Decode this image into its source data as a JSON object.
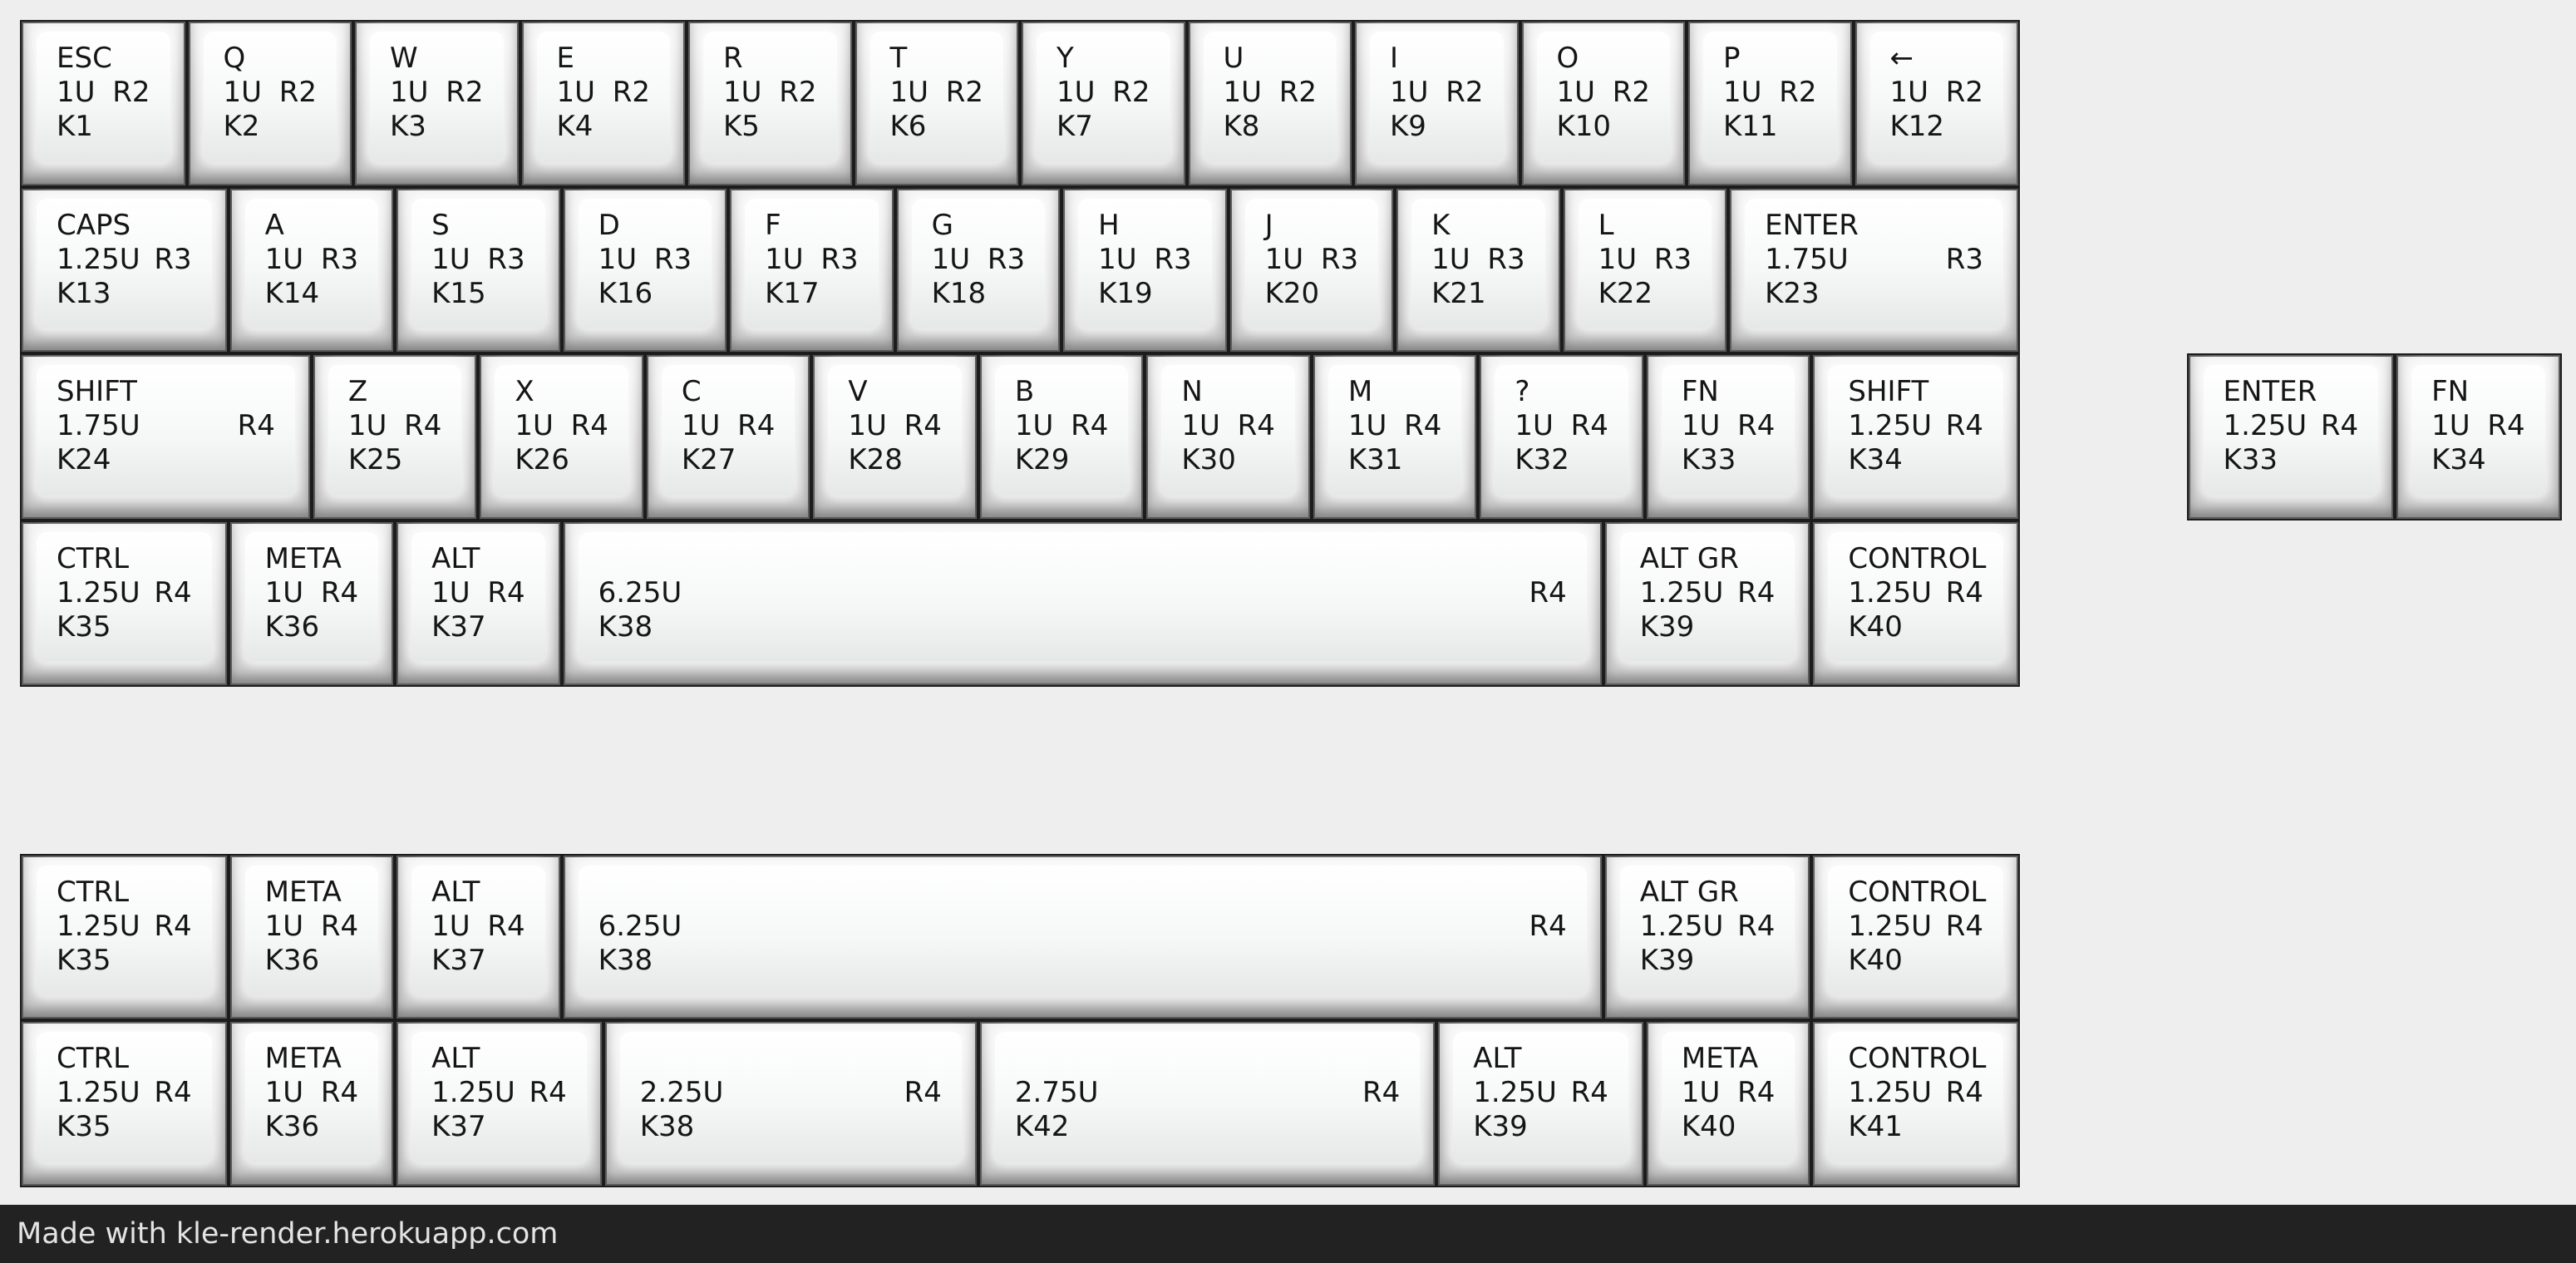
{
  "layout": {
    "rows": [
      {
        "y": 0,
        "keys": [
          {
            "tl": "ESC",
            "ml": "1U",
            "mr": "R2",
            "bl": "K1"
          },
          {
            "tl": "Q",
            "ml": "1U",
            "mr": "R2",
            "bl": "K2"
          },
          {
            "tl": "W",
            "ml": "1U",
            "mr": "R2",
            "bl": "K3"
          },
          {
            "tl": "E",
            "ml": "1U",
            "mr": "R2",
            "bl": "K4"
          },
          {
            "tl": "R",
            "ml": "1U",
            "mr": "R2",
            "bl": "K5"
          },
          {
            "tl": "T",
            "ml": "1U",
            "mr": "R2",
            "bl": "K6"
          },
          {
            "tl": "Y",
            "ml": "1U",
            "mr": "R2",
            "bl": "K7"
          },
          {
            "tl": "U",
            "ml": "1U",
            "mr": "R2",
            "bl": "K8"
          },
          {
            "tl": "I",
            "ml": "1U",
            "mr": "R2",
            "bl": "K9"
          },
          {
            "tl": "O",
            "ml": "1U",
            "mr": "R2",
            "bl": "K10"
          },
          {
            "tl": "P",
            "ml": "1U",
            "mr": "R2",
            "bl": "K11"
          },
          {
            "tl": "←",
            "ml": "1U",
            "mr": "R2",
            "bl": "K12"
          }
        ]
      },
      {
        "y": 1,
        "keys": [
          {
            "w": 1.25,
            "tl": "CAPS",
            "ml": "1.25U",
            "mr": "R3",
            "bl": "K13"
          },
          {
            "tl": "A",
            "ml": "1U",
            "mr": "R3",
            "bl": "K14"
          },
          {
            "tl": "S",
            "ml": "1U",
            "mr": "R3",
            "bl": "K15"
          },
          {
            "tl": "D",
            "ml": "1U",
            "mr": "R3",
            "bl": "K16"
          },
          {
            "tl": "F",
            "ml": "1U",
            "mr": "R3",
            "bl": "K17"
          },
          {
            "tl": "G",
            "ml": "1U",
            "mr": "R3",
            "bl": "K18"
          },
          {
            "tl": "H",
            "ml": "1U",
            "mr": "R3",
            "bl": "K19"
          },
          {
            "tl": "J",
            "ml": "1U",
            "mr": "R3",
            "bl": "K20"
          },
          {
            "tl": "K",
            "ml": "1U",
            "mr": "R3",
            "bl": "K21"
          },
          {
            "tl": "L",
            "ml": "1U",
            "mr": "R3",
            "bl": "K22"
          },
          {
            "w": 1.75,
            "tl": "ENTER",
            "ml": "1.75U",
            "mr": "R3",
            "bl": "K23"
          }
        ]
      },
      {
        "y": 2,
        "keys": [
          {
            "w": 1.75,
            "tl": "SHIFT",
            "ml": "1.75U",
            "mr": "R4",
            "bl": "K24"
          },
          {
            "tl": "Z",
            "ml": "1U",
            "mr": "R4",
            "bl": "K25"
          },
          {
            "tl": "X",
            "ml": "1U",
            "mr": "R4",
            "bl": "K26"
          },
          {
            "tl": "C",
            "ml": "1U",
            "mr": "R4",
            "bl": "K27"
          },
          {
            "tl": "V",
            "ml": "1U",
            "mr": "R4",
            "bl": "K28"
          },
          {
            "tl": "B",
            "ml": "1U",
            "mr": "R4",
            "bl": "K29"
          },
          {
            "tl": "N",
            "ml": "1U",
            "mr": "R4",
            "bl": "K30"
          },
          {
            "tl": "M",
            "ml": "1U",
            "mr": "R4",
            "bl": "K31"
          },
          {
            "tl": "?",
            "ml": "1U",
            "mr": "R4",
            "bl": "K32"
          },
          {
            "tl": "FN",
            "ml": "1U",
            "mr": "R4",
            "bl": "K33"
          },
          {
            "w": 1.25,
            "tl": "SHIFT",
            "ml": "1.25U",
            "mr": "R4",
            "bl": "K34"
          },
          {
            "x": 1,
            "w": 1.25,
            "tl": "ENTER",
            "ml": "1.25U",
            "mr": "R4",
            "bl": "K33"
          },
          {
            "tl": "FN",
            "ml": "1U",
            "mr": "R4",
            "bl": "K34"
          }
        ]
      },
      {
        "y": 3,
        "keys": [
          {
            "w": 1.25,
            "tl": "CTRL",
            "ml": "1.25U",
            "mr": "R4",
            "bl": "K35"
          },
          {
            "tl": "META",
            "ml": "1U",
            "mr": "R4",
            "bl": "K36"
          },
          {
            "tl": "ALT",
            "ml": "1U",
            "mr": "R4",
            "bl": "K37"
          },
          {
            "w": 6.25,
            "tl": "",
            "ml": "6.25U",
            "mr": "R4",
            "bl": "K38"
          },
          {
            "w": 1.25,
            "tl": "ALT GR",
            "ml": "1.25U",
            "mr": "R4",
            "bl": "K39"
          },
          {
            "w": 1.25,
            "tl": "CONTROL",
            "ml": "1.25U",
            "mr": "R4",
            "bl": "K40"
          }
        ]
      },
      {
        "y": 5,
        "keys": [
          {
            "w": 1.25,
            "tl": "CTRL",
            "ml": "1.25U",
            "mr": "R4",
            "bl": "K35"
          },
          {
            "tl": "META",
            "ml": "1U",
            "mr": "R4",
            "bl": "K36"
          },
          {
            "tl": "ALT",
            "ml": "1U",
            "mr": "R4",
            "bl": "K37"
          },
          {
            "w": 6.25,
            "tl": "",
            "ml": "6.25U",
            "mr": "R4",
            "bl": "K38"
          },
          {
            "w": 1.25,
            "tl": "ALT GR",
            "ml": "1.25U",
            "mr": "R4",
            "bl": "K39"
          },
          {
            "w": 1.25,
            "tl": "CONTROL",
            "ml": "1.25U",
            "mr": "R4",
            "bl": "K40"
          }
        ]
      },
      {
        "y": 6,
        "keys": [
          {
            "w": 1.25,
            "tl": "CTRL",
            "ml": "1.25U",
            "mr": "R4",
            "bl": "K35"
          },
          {
            "tl": "META",
            "ml": "1U",
            "mr": "R4",
            "bl": "K36"
          },
          {
            "w": 1.25,
            "tl": "ALT",
            "ml": "1.25U",
            "mr": "R4",
            "bl": "K37"
          },
          {
            "w": 2.25,
            "tl": "",
            "ml": "2.25U",
            "mr": "R4",
            "bl": "K38"
          },
          {
            "w": 2.75,
            "tl": "",
            "ml": "2.75U",
            "mr": "R4",
            "bl": "K42"
          },
          {
            "w": 1.25,
            "tl": "ALT",
            "ml": "1.25U",
            "mr": "R4",
            "bl": "K39"
          },
          {
            "tl": "META",
            "ml": "1U",
            "mr": "R4",
            "bl": "K40"
          },
          {
            "w": 1.25,
            "tl": "CONTROL",
            "ml": "1.25U",
            "mr": "R4",
            "bl": "K41"
          }
        ]
      }
    ]
  },
  "footer": {
    "text": "Made with kle-render.herokuapp.com"
  }
}
